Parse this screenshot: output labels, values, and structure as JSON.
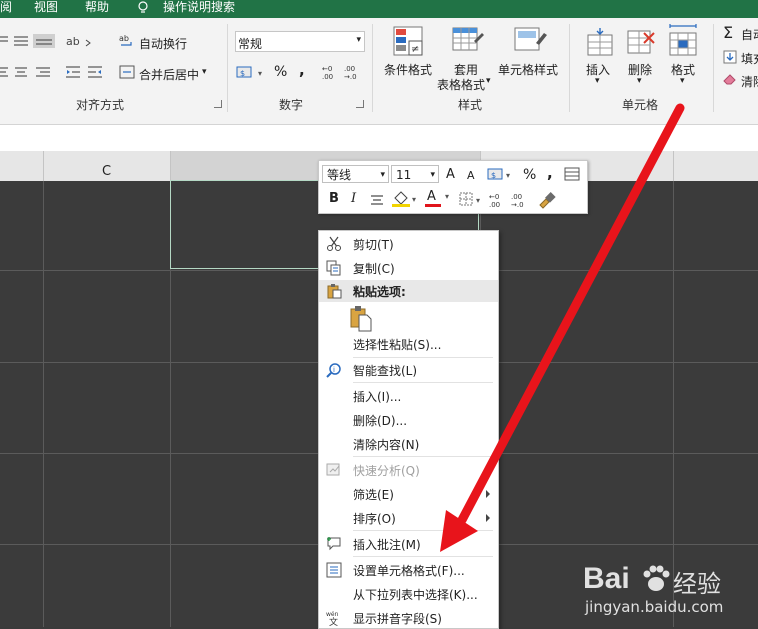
{
  "menubar": {
    "items": [
      "阅",
      "视图",
      "帮助",
      "操作说明搜索"
    ]
  },
  "ribbon": {
    "align": {
      "wrap_text": "自动换行",
      "merge_center": "合并后居中",
      "group_label": "对齐方式"
    },
    "number": {
      "format_value": "常规",
      "percent": "%",
      "comma": ",",
      "group_label": "数字"
    },
    "styles": {
      "conditional_format": "条件格式",
      "table_format_line1": "套用",
      "table_format_line2": "表格格式",
      "cell_styles": "单元格样式",
      "group_label": "样式"
    },
    "cells": {
      "insert": "插入",
      "delete": "删除",
      "format": "格式",
      "group_label": "单元格"
    },
    "editing": {
      "autosum": "自动",
      "fill": "填充",
      "clear": "清除"
    }
  },
  "columns": {
    "c_label": "C"
  },
  "mini_toolbar": {
    "font_name": "等线",
    "font_size": "11",
    "percent": "%",
    "comma": ",",
    "bold": "B",
    "italic": "I",
    "font_color_letter": "A",
    "increase_font": "A",
    "decrease_font": "A"
  },
  "context_menu": {
    "cut": "剪切(T)",
    "copy": "复制(C)",
    "paste_options": "粘贴选项:",
    "paste_special": "选择性粘贴(S)...",
    "smart_lookup": "智能查找(L)",
    "insert": "插入(I)...",
    "delete": "删除(D)...",
    "clear_contents": "清除内容(N)",
    "quick_analysis": "快速分析(Q)",
    "filter": "筛选(E)",
    "sort": "排序(O)",
    "insert_comment": "插入批注(M)",
    "format_cells": "设置单元格格式(F)...",
    "pick_from_list": "从下拉列表中选择(K)...",
    "show_phonetic": "显示拼音字段(S)"
  },
  "watermark": {
    "brand": "Bai",
    "brand_cn": "经验",
    "url": "jingyan.baidu.com"
  },
  "colors": {
    "excel_green": "#217346",
    "arrow_red": "#e8141b",
    "grid_dark": "#3b3b3b"
  }
}
